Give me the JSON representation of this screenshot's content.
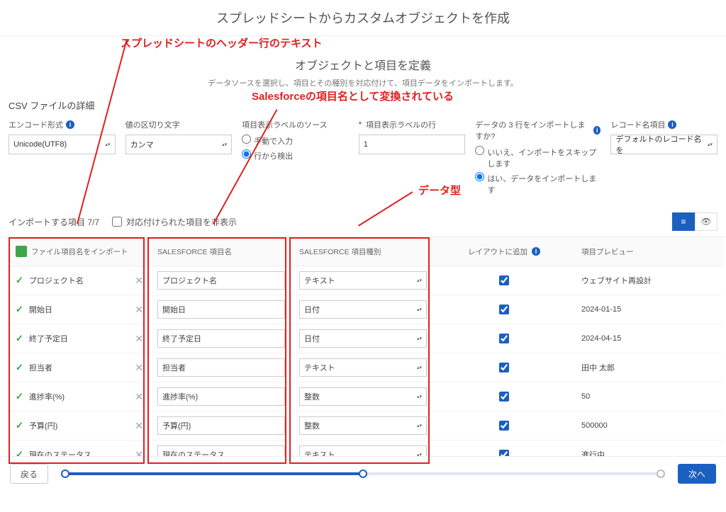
{
  "pageTitle": "スプレッドシートからカスタムオブジェクトを作成",
  "subTitle": "オブジェクトと項目を定義",
  "helper": "データソースを選択し、項目とその種別を対応付けて、項目データをインポートします。",
  "annotations": {
    "a1": "スプレッドシートのヘッダー行のテキスト",
    "a2": "Salesforceの項目名として変換されている",
    "a3": "データ型"
  },
  "csvDetailTitle": "CSV ファイルの詳細",
  "config": {
    "encodingLabel": "エンコード形式",
    "encodingValue": "Unicode(UTF8)",
    "delimiterLabel": "値の区切り文字",
    "delimiterValue": "カンマ",
    "labelSourceLabel": "項目表示ラベルのソース",
    "labelSourceOpt1": "手動で入力",
    "labelSourceOpt2": "行から検出",
    "labelRowLabel": "項目表示ラベルの行",
    "labelRowValue": "1",
    "importRowsLabel": "データの 3 行をインポートしますか?",
    "importRowsOpt1": "いいえ、インポートをスキップします",
    "importRowsOpt2": "はい、データをインポートします",
    "recordNameLabel": "レコード名項目",
    "recordNameValue": "デフォルトのレコード名を"
  },
  "importBar": {
    "count": "インポートする項目 7/7",
    "hideMapped": "対応付けられた項目を非表示"
  },
  "headers": {
    "fileField": "ファイル項目名をインポート",
    "sfField": "SALESFORCE 項目名",
    "sfType": "SALESFORCE 項目種別",
    "addLayout": "レイアウトに追加",
    "preview": "項目プレビュー"
  },
  "rows": [
    {
      "file": "プロジェクト名",
      "sf": "プロジェクト名",
      "type": "テキスト",
      "layout": true,
      "preview": "ウェブサイト再設計"
    },
    {
      "file": "開始日",
      "sf": "開始日",
      "type": "日付",
      "layout": true,
      "preview": "2024-01-15"
    },
    {
      "file": "終了予定日",
      "sf": "終了予定日",
      "type": "日付",
      "layout": true,
      "preview": "2024-04-15"
    },
    {
      "file": "担当者",
      "sf": "担当者",
      "type": "テキスト",
      "layout": true,
      "preview": "田中 太郎"
    },
    {
      "file": "進捗率(%)",
      "sf": "進捗率(%)",
      "type": "整数",
      "layout": true,
      "preview": "50"
    },
    {
      "file": "予算(円)",
      "sf": "予算(円)",
      "type": "整数",
      "layout": true,
      "preview": "500000"
    },
    {
      "file": "現在のステータス",
      "sf": "現在のステータス",
      "type": "テキスト",
      "layout": true,
      "preview": "進行中"
    }
  ],
  "footer": {
    "back": "戻る",
    "next": "次へ"
  }
}
